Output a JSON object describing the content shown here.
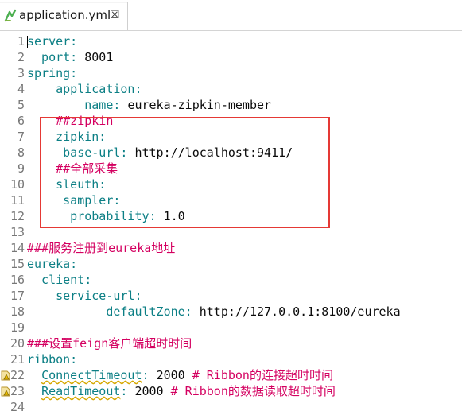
{
  "tab": {
    "label": "application.yml",
    "close": "☒",
    "icon": "yaml-file-icon"
  },
  "lines": [
    {
      "n": "1",
      "segments": [
        {
          "t": "server:",
          "c": "k"
        }
      ]
    },
    {
      "n": "2",
      "segments": [
        {
          "t": "  port: ",
          "c": "k"
        },
        {
          "t": "8001",
          "c": "v"
        }
      ]
    },
    {
      "n": "3",
      "segments": [
        {
          "t": "spring:",
          "c": "k"
        }
      ]
    },
    {
      "n": "4",
      "segments": [
        {
          "t": "    application:",
          "c": "k"
        }
      ]
    },
    {
      "n": "5",
      "segments": [
        {
          "t": "        name: ",
          "c": "k"
        },
        {
          "t": "eureka-zipkin-member",
          "c": "v"
        }
      ]
    },
    {
      "n": "6",
      "segments": [
        {
          "t": "    ##zipkin",
          "c": "c"
        }
      ]
    },
    {
      "n": "7",
      "segments": [
        {
          "t": "    zipkin:",
          "c": "k"
        }
      ]
    },
    {
      "n": "8",
      "segments": [
        {
          "t": "     base-url: ",
          "c": "k"
        },
        {
          "t": "http://localhost:9411/",
          "c": "v"
        }
      ]
    },
    {
      "n": "9",
      "segments": [
        {
          "t": "    ##全部采集",
          "c": "c"
        }
      ]
    },
    {
      "n": "10",
      "segments": [
        {
          "t": "    sleuth:",
          "c": "k"
        }
      ]
    },
    {
      "n": "11",
      "segments": [
        {
          "t": "     sampler:",
          "c": "k"
        }
      ]
    },
    {
      "n": "12",
      "segments": [
        {
          "t": "      probability: ",
          "c": "k"
        },
        {
          "t": "1.0",
          "c": "v"
        }
      ]
    },
    {
      "n": "13",
      "segments": []
    },
    {
      "n": "14",
      "segments": [
        {
          "t": "###服务注册到eureka地址",
          "c": "c"
        }
      ]
    },
    {
      "n": "15",
      "segments": [
        {
          "t": "eureka:",
          "c": "k"
        }
      ]
    },
    {
      "n": "16",
      "segments": [
        {
          "t": "  client:",
          "c": "k"
        }
      ]
    },
    {
      "n": "17",
      "segments": [
        {
          "t": "    service-url:",
          "c": "k"
        }
      ]
    },
    {
      "n": "18",
      "segments": [
        {
          "t": "           defaultZone: ",
          "c": "k"
        },
        {
          "t": "http://127.0.0.1:8100/eureka",
          "c": "v"
        }
      ]
    },
    {
      "n": "19",
      "segments": []
    },
    {
      "n": "20",
      "segments": [
        {
          "t": "###设置feign客户端超时时间",
          "c": "c"
        }
      ]
    },
    {
      "n": "21",
      "segments": [
        {
          "t": "ribbon:",
          "c": "k"
        }
      ]
    },
    {
      "n": "22",
      "warn": true,
      "segments": [
        {
          "t": "  ",
          "c": "k"
        },
        {
          "t": "ConnectTimeout",
          "c": "k",
          "u": true
        },
        {
          "t": ": ",
          "c": "k"
        },
        {
          "t": "2000 ",
          "c": "v"
        },
        {
          "t": "# Ribbon的连接超时时间",
          "c": "c"
        }
      ]
    },
    {
      "n": "23",
      "warn": true,
      "segments": [
        {
          "t": "  ",
          "c": "k"
        },
        {
          "t": "ReadTimeout",
          "c": "k",
          "u": true
        },
        {
          "t": ": ",
          "c": "k"
        },
        {
          "t": "2000 ",
          "c": "v"
        },
        {
          "t": "# Ribbon的数据读取超时时间",
          "c": "c"
        }
      ]
    },
    {
      "n": "24",
      "segments": []
    }
  ]
}
